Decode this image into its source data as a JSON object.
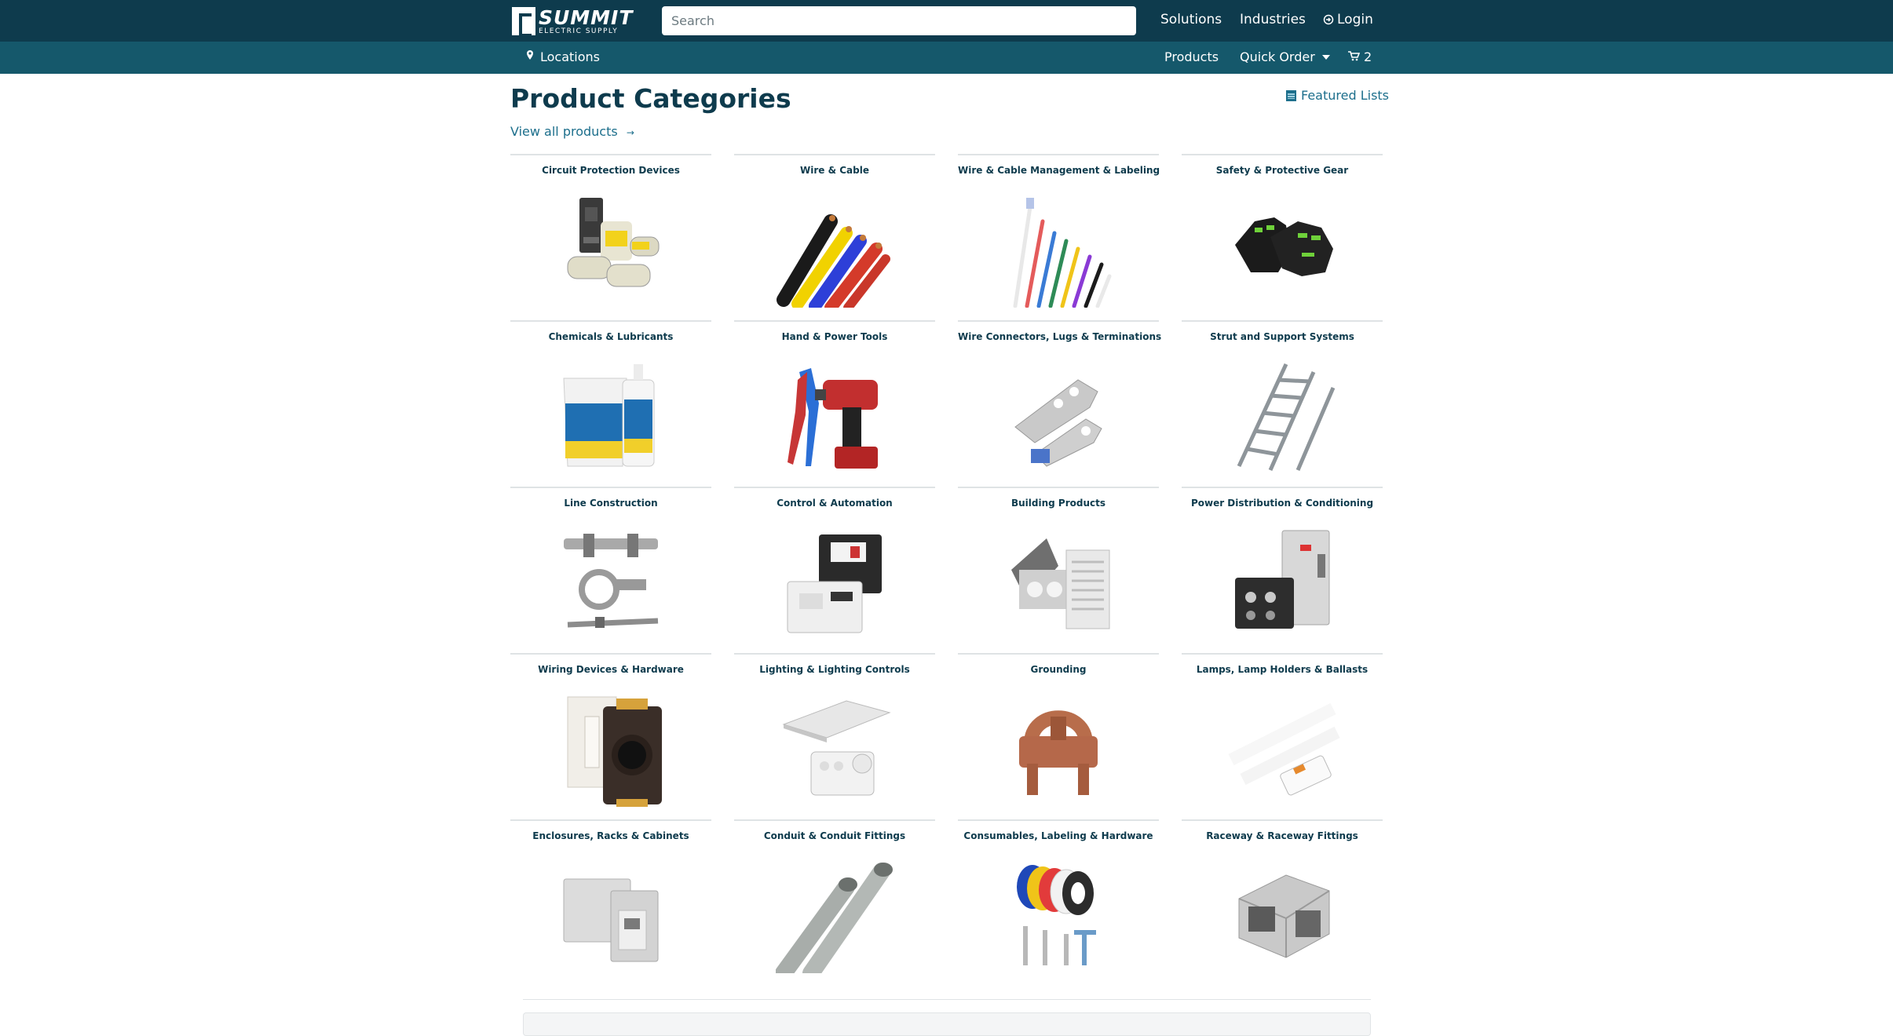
{
  "header": {
    "logo_text": "SUMMIT",
    "logo_subtext": "ELECTRIC SUPPLY",
    "search_placeholder": "Search",
    "nav": {
      "solutions": "Solutions",
      "industries": "Industries",
      "login": "Login"
    }
  },
  "subnav": {
    "locations": "Locations",
    "products": "Products",
    "quick_order": "Quick Order",
    "cart_count": "2"
  },
  "main": {
    "title": "Product Categories",
    "view_all": "View all products",
    "featured_lists": "Featured Lists",
    "categories": [
      {
        "label": "Circuit Protection Devices",
        "icon": "breaker-fuses-icon"
      },
      {
        "label": "Wire & Cable",
        "icon": "wire-cable-icon"
      },
      {
        "label": "Wire & Cable Management & Labeling",
        "icon": "cable-ties-icon"
      },
      {
        "label": "Safety & Protective Gear",
        "icon": "gloves-icon"
      },
      {
        "label": "Chemicals & Lubricants",
        "icon": "lubricant-bucket-icon"
      },
      {
        "label": "Hand & Power Tools",
        "icon": "drill-pliers-icon"
      },
      {
        "label": "Wire Connectors, Lugs & Terminations",
        "icon": "lugs-icon"
      },
      {
        "label": "Strut and Support Systems",
        "icon": "cable-tray-icon"
      },
      {
        "label": "Line Construction",
        "icon": "line-hardware-icon"
      },
      {
        "label": "Control & Automation",
        "icon": "contactor-icon"
      },
      {
        "label": "Building Products",
        "icon": "exhaust-fan-icon"
      },
      {
        "label": "Power Distribution & Conditioning",
        "icon": "disconnect-switch-icon"
      },
      {
        "label": "Wiring Devices & Hardware",
        "icon": "receptacle-dimmer-icon"
      },
      {
        "label": "Lighting & Lighting Controls",
        "icon": "light-fixture-icon"
      },
      {
        "label": "Grounding",
        "icon": "ground-clamp-icon"
      },
      {
        "label": "Lamps, Lamp Holders & Ballasts",
        "icon": "led-tubes-icon"
      },
      {
        "label": "Enclosures, Racks & Cabinets",
        "icon": "enclosure-icon"
      },
      {
        "label": "Conduit & Conduit Fittings",
        "icon": "conduit-icon"
      },
      {
        "label": "Consumables, Labeling & Hardware",
        "icon": "tape-screws-icon"
      },
      {
        "label": "Raceway & Raceway Fittings",
        "icon": "raceway-fitting-icon"
      }
    ]
  },
  "colors": {
    "topbar": "#0e3b4d",
    "subbar": "#15586b",
    "link": "#1d6f8c",
    "heading": "#0e3b4d"
  }
}
